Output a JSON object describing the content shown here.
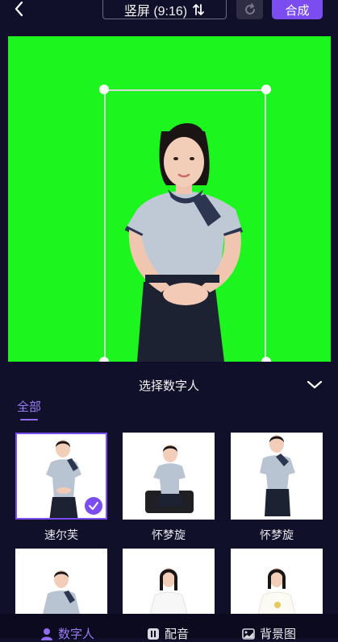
{
  "header": {
    "orientation_label": "竖屏 (9:16)",
    "compose_label": "合成"
  },
  "panel": {
    "title": "选择数字人",
    "tabs": [
      {
        "label": "全部",
        "active": true
      }
    ]
  },
  "avatars": [
    {
      "name": "速尔芙",
      "selected": true
    },
    {
      "name": "怀梦旋",
      "selected": false
    },
    {
      "name": "怀梦旋",
      "selected": false
    },
    {
      "name": "",
      "selected": false
    },
    {
      "name": "",
      "selected": false
    },
    {
      "name": "",
      "selected": false
    }
  ],
  "bottom_nav": [
    {
      "label": "数字人",
      "icon": "person-icon",
      "active": true
    },
    {
      "label": "配音",
      "icon": "voice-icon",
      "active": false
    },
    {
      "label": "背景图",
      "icon": "image-icon",
      "active": false
    }
  ],
  "colors": {
    "accent": "#7b4cf0",
    "background": "#11102a",
    "green_screen": "#1df51f"
  }
}
